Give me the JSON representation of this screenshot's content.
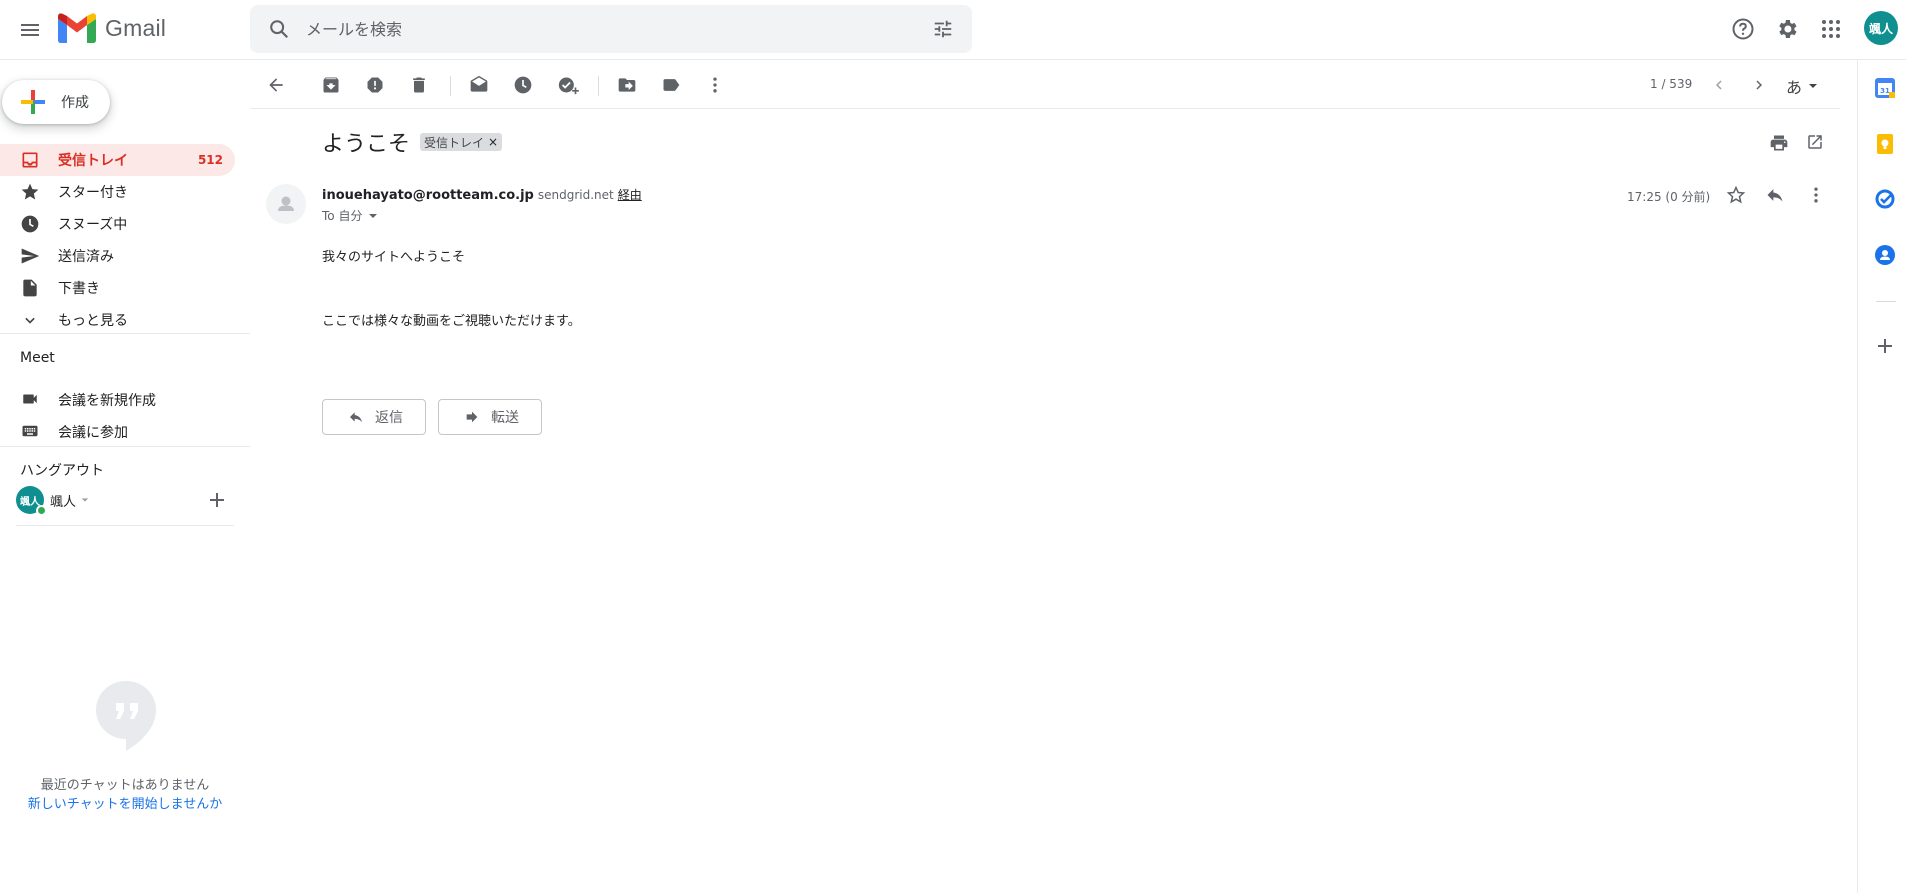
{
  "header": {
    "app_name": "Gmail",
    "search_placeholder": "メールを検索",
    "avatar_text": "颯人"
  },
  "sidebar": {
    "compose_label": "作成",
    "items": [
      {
        "label": "受信トレイ",
        "count": "512",
        "icon": "inbox-icon",
        "active": true
      },
      {
        "label": "スター付き",
        "icon": "star-icon"
      },
      {
        "label": "スヌーズ中",
        "icon": "clock-icon"
      },
      {
        "label": "送信済み",
        "icon": "send-icon"
      },
      {
        "label": "下書き",
        "icon": "draft-icon"
      },
      {
        "label": "もっと見る",
        "icon": "chevron-down-icon"
      }
    ],
    "meet": {
      "title": "Meet",
      "new_meeting": "会議を新規作成",
      "join_meeting": "会議に参加"
    },
    "hangouts": {
      "title": "ハングアウト",
      "user_name": "颯人",
      "avatar_text": "颯人",
      "no_chats": "最近のチャットはありません",
      "start_chat": "新しいチャットを開始しませんか"
    }
  },
  "toolbar": {
    "pager": "1 / 539",
    "lang": "あ"
  },
  "message": {
    "subject": "ようこそ",
    "label": "受信トレイ",
    "sender_email": "inouehayato@rootteam.co.jp",
    "via_domain": "sendgrid.net",
    "via_label": "経由",
    "to": "To 自分",
    "time": "17:25 (0 分前)",
    "body_lines": [
      "我々のサイトへようこそ",
      "ここでは様々な動画をご視聴いただけます。"
    ],
    "reply_label": "返信",
    "forward_label": "転送"
  },
  "colors": {
    "accent_red": "#d93025",
    "active_bg": "#fce8e6",
    "avatar_teal": "#0f8f8f",
    "link_blue": "#1a73e8"
  }
}
